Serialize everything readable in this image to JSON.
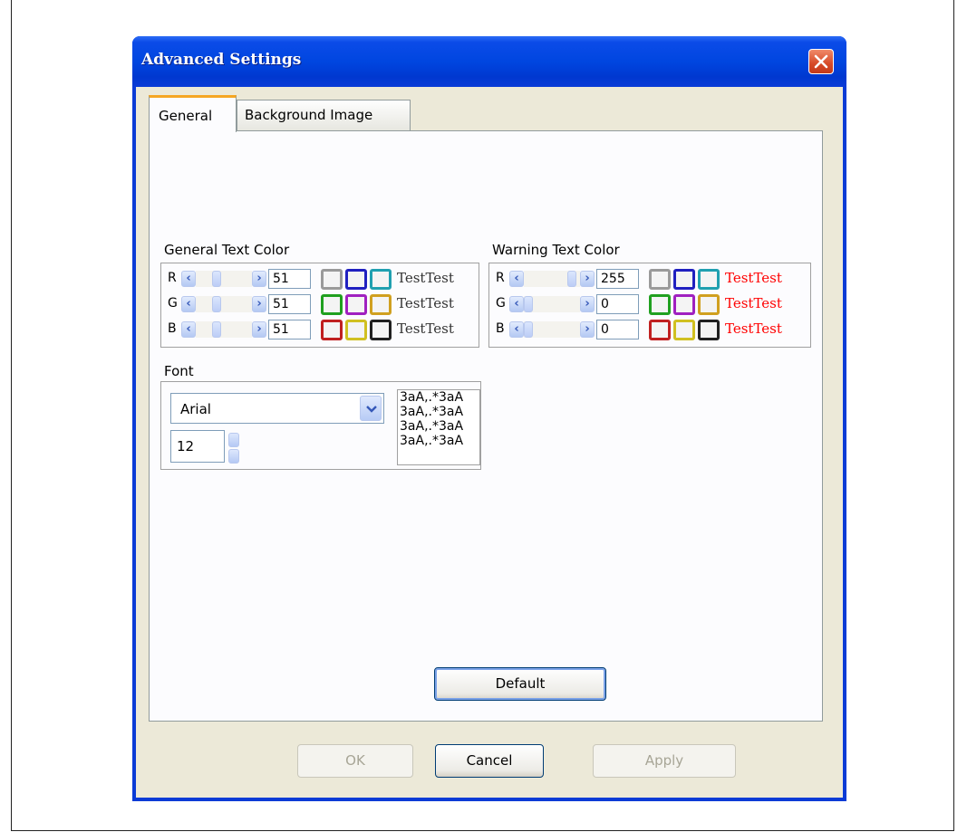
{
  "dialog": {
    "title": "Advanced Settings"
  },
  "tabs": [
    {
      "label": "General",
      "selected": true
    },
    {
      "label": "Background Image",
      "selected": false
    }
  ],
  "general_text_color": {
    "label": "General Text Color",
    "channels": [
      {
        "name": "R",
        "value": "51"
      },
      {
        "name": "G",
        "value": "51"
      },
      {
        "name": "B",
        "value": "51"
      }
    ],
    "sample_text": "TestTest",
    "sample_color": "#333333"
  },
  "warning_text_color": {
    "label": "Warning Text Color",
    "channels": [
      {
        "name": "R",
        "value": "255"
      },
      {
        "name": "G",
        "value": "0"
      },
      {
        "name": "B",
        "value": "0"
      }
    ],
    "sample_text": "TestTest",
    "sample_color": "#ff0000"
  },
  "swatch_colors": [
    [
      "#9a9a9a",
      "#2020c0",
      "#20a0b0"
    ],
    [
      "#20a020",
      "#a020c0",
      "#d0a020"
    ],
    [
      "#c02020",
      "#d0c020",
      "#202020"
    ]
  ],
  "font": {
    "label": "Font",
    "family": "Arial",
    "size": "12",
    "preview_lines": [
      "3aA,.*3aA",
      "3aA,.*3aA",
      "3aA,.*3aA",
      "3aA,.*3aA"
    ]
  },
  "buttons": {
    "default": "Default",
    "ok": "OK",
    "cancel": "Cancel",
    "apply": "Apply"
  }
}
